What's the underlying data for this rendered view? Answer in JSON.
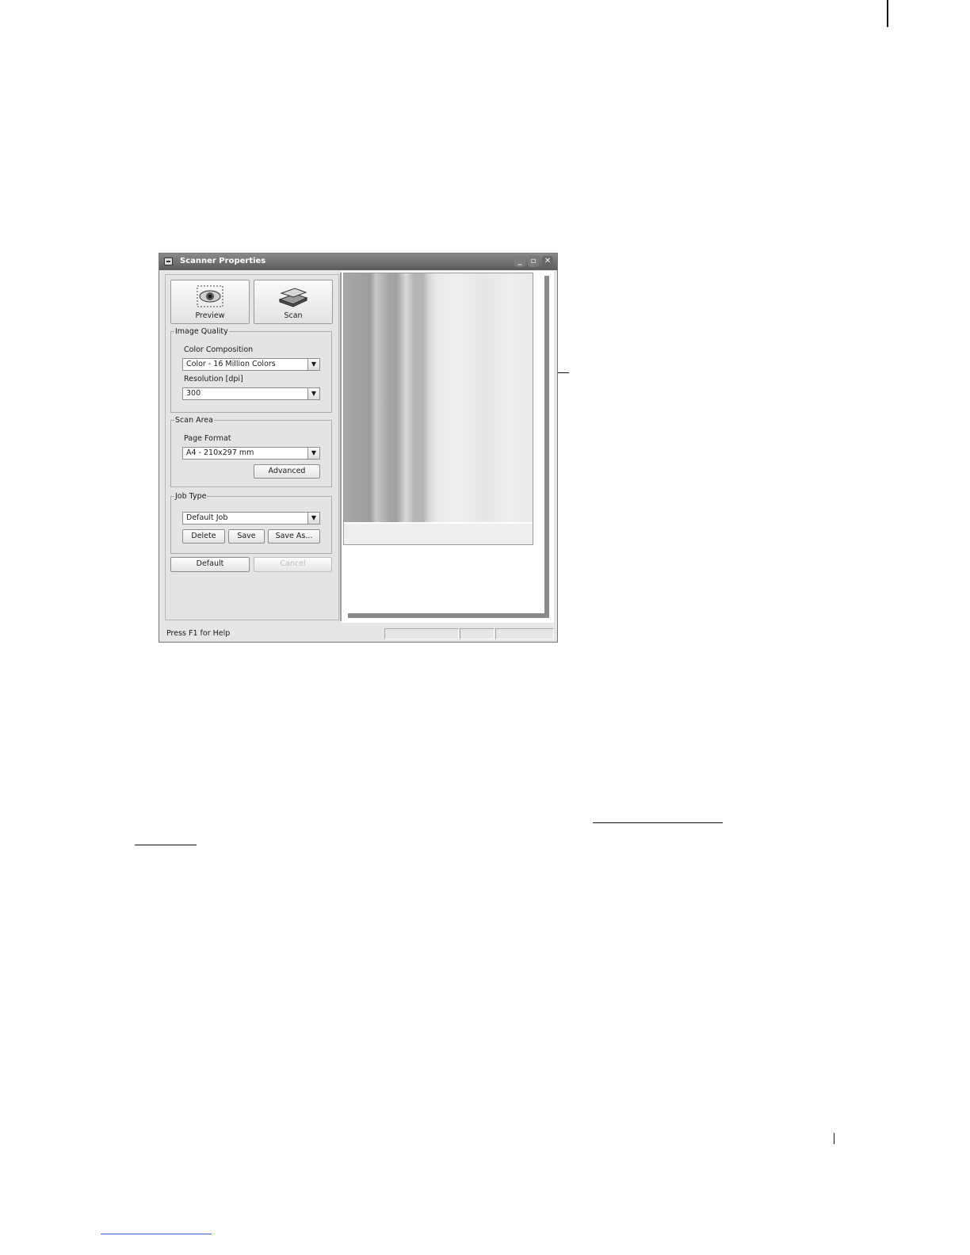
{
  "window": {
    "title": "Scanner Properties",
    "controls": {
      "minimize": "_",
      "maximize": "▫",
      "close": "✕"
    }
  },
  "toolbar": {
    "preview_label": "Preview",
    "scan_label": "Scan"
  },
  "image_quality": {
    "legend": "Image Quality",
    "color_label": "Color Composition",
    "color_value": "Color - 16 Million Colors",
    "resolution_label": "Resolution [dpi]",
    "resolution_value": "300"
  },
  "scan_area": {
    "legend": "Scan Area",
    "page_format_label": "Page Format",
    "page_format_value": "A4 - 210x297 mm",
    "advanced_label": "Advanced"
  },
  "job_type": {
    "legend": "Job Type",
    "job_value": "Default Job",
    "delete_label": "Delete",
    "save_label": "Save",
    "save_as_label": "Save As..."
  },
  "bottom_buttons": {
    "default_label": "Default",
    "cancel_label": "Cancel"
  },
  "status": {
    "text": "Press F1 for Help"
  },
  "icons": {
    "preview": "eye-icon",
    "scan": "flatbed-scanner-icon",
    "dropdown": "chevron-down-icon"
  }
}
